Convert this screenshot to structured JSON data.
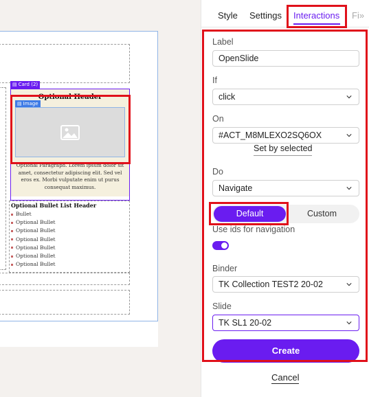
{
  "canvas": {
    "card_tag": "Card (2)",
    "image_tag": "Image",
    "optional_header": "Optional Header",
    "optional_paragraph": "Optional Paragraph. Lorem ipsum dolor sit amet, consectetur adipiscing elit. Sed vel eros ex. Morbi vulputate enim ut purus consequat maximus.",
    "bullet_header": "Optional Bullet List Header",
    "bullets": [
      "Bullet",
      "Optional Bullet",
      "Optional Bullet",
      "Optional Bullet",
      "Optional Bullet",
      "Optional Bullet",
      "Optional Bullet"
    ]
  },
  "tabs": {
    "style": "Style",
    "settings": "Settings",
    "interactions": "Interactions",
    "overflow": "Fi"
  },
  "form": {
    "label_label": "Label",
    "label_value": "OpenSlide",
    "if_label": "If",
    "if_value": "click",
    "on_label": "On",
    "on_value": "#ACT_M8MLEXO2SQ6OX",
    "set_by_selected": "Set by selected",
    "do_label": "Do",
    "do_value": "Navigate",
    "mode_default": "Default",
    "mode_custom": "Custom",
    "use_ids_label": "Use ids for navigation",
    "use_ids_on": true,
    "binder_label": "Binder",
    "binder_value": "TK Collection TEST2 20-02",
    "slide_label": "Slide",
    "slide_value": "TK SL1 20-02",
    "create_label": "Create",
    "cancel_label": "Cancel"
  },
  "colors": {
    "accent": "#6a1cf0",
    "highlight": "#e0101a",
    "image_tag": "#3f7be6",
    "card_bg": "#f5f0de"
  }
}
